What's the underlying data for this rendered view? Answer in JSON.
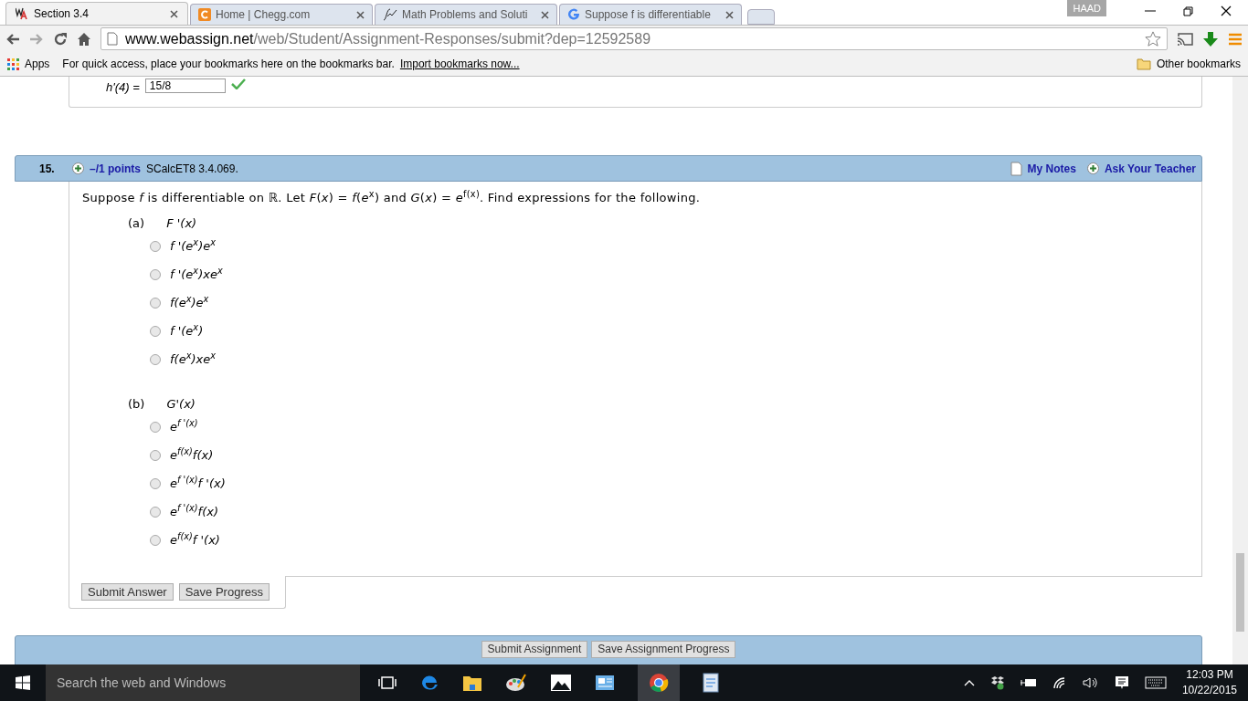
{
  "tabs": [
    {
      "title": "Section 3.4",
      "selected": true
    },
    {
      "title": "Home | Chegg.com",
      "selected": false
    },
    {
      "title": "Math Problems and Soluti",
      "selected": false
    },
    {
      "title": "Suppose f is differentiable",
      "selected": false
    }
  ],
  "profile": "HAAD",
  "address": {
    "host": "www.webassign.net",
    "path": "/web/Student/Assignment-Responses/submit?dep=12592589"
  },
  "bookmarks_bar": {
    "apps": "Apps",
    "hint": "For quick access, place your bookmarks here on the bookmarks bar.",
    "import_link": "Import bookmarks now...",
    "other": "Other bookmarks"
  },
  "previous_answer": {
    "label": "h'(4) =",
    "value": "15/8",
    "correct": true
  },
  "question": {
    "number": "15.",
    "points": "–/1 points",
    "code": "SCalcET8 3.4.069.",
    "my_notes": "My Notes",
    "ask_teacher": "Ask Your Teacher",
    "text": "Suppose *f* is differentiable on ℝ. Let *F*(*x*) = *f*(*e*$^{x}$)  and  *G*(*x*) = *e*$^{f(x)}$.  Find expressions for the following.",
    "parts": [
      {
        "label": "(a)",
        "prompt": "F '(x)",
        "options": [
          {
            "text": "f '(e$^{x}$)e$^{x}$",
            "selected": false
          },
          {
            "text": "f '(e$^{x}$)xe$^{x}$",
            "selected": false
          },
          {
            "text": "f(e$^{x}$)e$^{x}$",
            "selected": false
          },
          {
            "text": "f '(e$^{x}$)",
            "selected": false
          },
          {
            "text": "f(e$^{x}$)xe$^{x}$",
            "selected": false
          }
        ]
      },
      {
        "label": "(b)",
        "prompt": "G'(x)",
        "options": [
          {
            "text": "e$^{f '(x)}$",
            "selected": false
          },
          {
            "text": "e$^{f(x)}$f(x)",
            "selected": false
          },
          {
            "text": "e$^{f '(x)}$f '(x)",
            "selected": false
          },
          {
            "text": "e$^{f '(x)}$f(x)",
            "selected": false
          },
          {
            "text": "e$^{f(x)}$f '(x)",
            "selected": false
          }
        ]
      }
    ],
    "buttons": [
      "Submit Answer",
      "Save Progress"
    ]
  },
  "assignment_buttons": [
    "Submit Assignment",
    "Save Assignment Progress"
  ],
  "taskbar": {
    "search": "Search the web and Windows",
    "time": "12:03 PM",
    "date": "10/22/2015"
  }
}
